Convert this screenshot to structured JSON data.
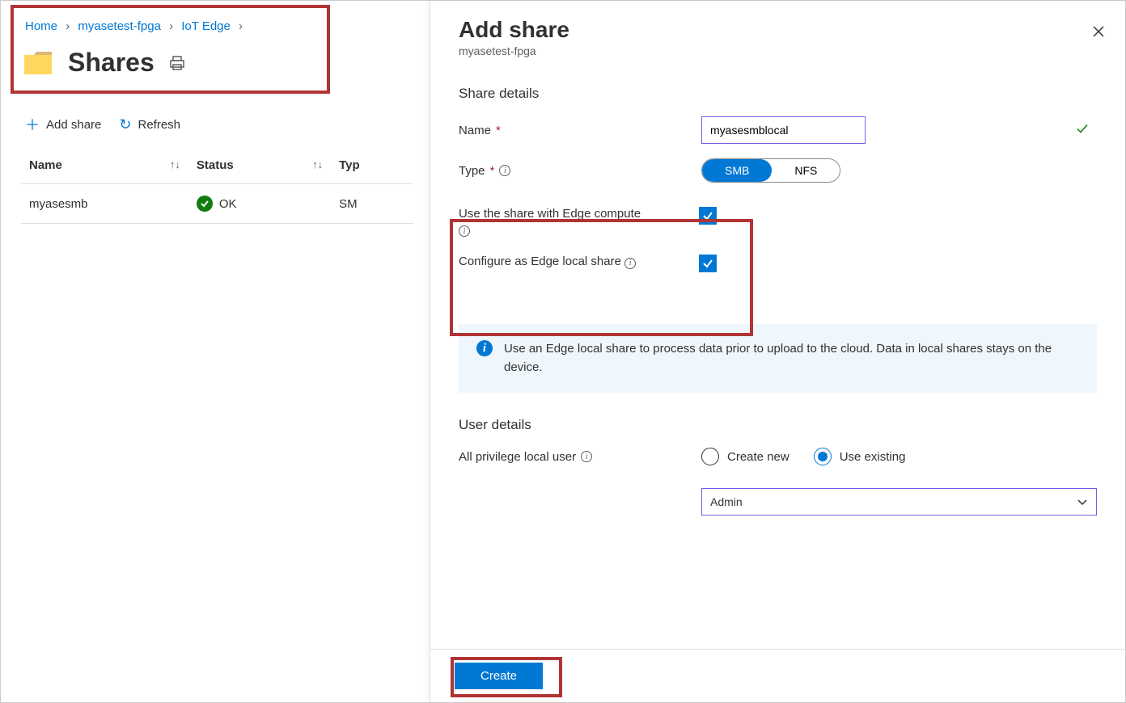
{
  "breadcrumb": {
    "home": "Home",
    "resource": "myasetest-fpga",
    "section": "IoT Edge"
  },
  "page": {
    "title": "Shares"
  },
  "toolbar": {
    "add_share": "Add share",
    "refresh": "Refresh"
  },
  "table": {
    "headers": {
      "name": "Name",
      "status": "Status",
      "type": "Typ"
    },
    "rows": [
      {
        "name": "myasesmb",
        "status_text": "OK",
        "type": "SM"
      }
    ]
  },
  "panel": {
    "title": "Add share",
    "subtitle": "myasetest-fpga"
  },
  "share_details": {
    "heading": "Share details",
    "name_label": "Name",
    "name_value": "myasesmblocal",
    "type_label": "Type",
    "type_options": {
      "smb": "SMB",
      "nfs": "NFS"
    },
    "edge_compute_label": "Use the share with Edge compute",
    "edge_local_label": "Configure as Edge local share",
    "info_text": "Use an Edge local share to process data prior to upload to the cloud. Data in local shares stays on the device."
  },
  "user_details": {
    "heading": "User details",
    "privilege_label": "All privilege local user",
    "create_new": "Create new",
    "use_existing": "Use existing",
    "selected_user": "Admin"
  },
  "footer": {
    "create": "Create"
  }
}
